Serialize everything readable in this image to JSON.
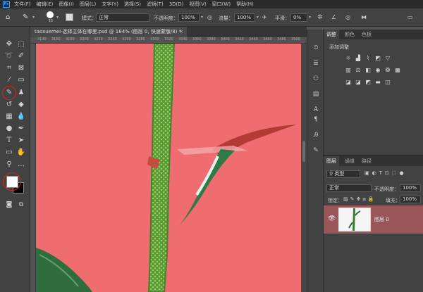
{
  "app": {
    "logo": "Ps"
  },
  "menu": [
    "文件(F)",
    "编辑(E)",
    "图像(I)",
    "图层(L)",
    "文字(Y)",
    "选择(S)",
    "滤镜(T)",
    "3D(D)",
    "视图(V)",
    "窗口(W)",
    "帮助(H)"
  ],
  "options": {
    "brush_size": "15",
    "mode_label": "模式：",
    "mode_value": "正常",
    "opacity_label": "不透明度：",
    "opacity_value": "100%",
    "flow_label": "流量：",
    "flow_value": "100%",
    "smoothing_label": "平滑：",
    "smoothing_value": "0%"
  },
  "document": {
    "tab_title": "taoxuemei-选择主体在哪里.psd @ 164% (图层 0, 快速蒙版/8) *",
    "close": "×",
    "ruler_ticks": [
      "3140",
      "3160",
      "3180",
      "3200",
      "3220",
      "3240",
      "3260",
      "3280",
      "3300",
      "3320",
      "3340",
      "3360",
      "3380",
      "3400",
      "3420",
      "3440",
      "3460",
      "3480",
      "3500"
    ]
  },
  "adjustments": {
    "tabs": [
      "调整",
      "颜色",
      "色板"
    ],
    "add_label": "添加调整"
  },
  "layers": {
    "tabs": [
      "图层",
      "通道",
      "路径"
    ],
    "kind_label": "类型",
    "blend_mode": "正常",
    "opacity_label": "不透明度：",
    "opacity_value": "100%",
    "lock_label": "锁定：",
    "fill_label": "填充：",
    "fill_value": "100%",
    "layer_name": "图层 0"
  },
  "colors": {
    "canvas_bg": "#ef6d70",
    "stem": "#5e9e3a",
    "highlight": "#e02020",
    "layer_selected": "#9a5659"
  }
}
